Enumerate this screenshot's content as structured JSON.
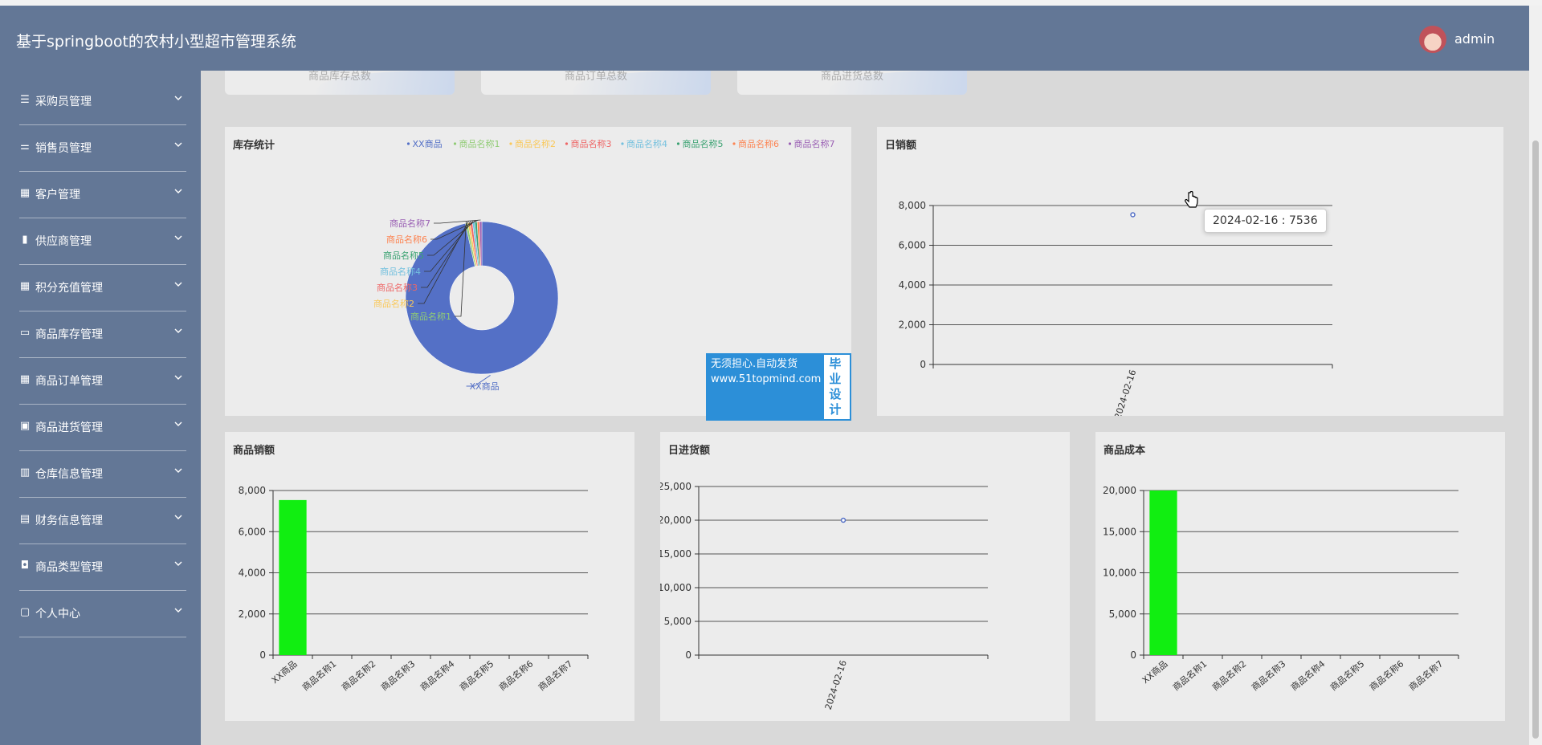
{
  "app": {
    "title": "基于springboot的农村小型超市管理系统",
    "user": "admin"
  },
  "sidebar": {
    "items": [
      {
        "label": "采购员管理",
        "icon": "list-icon"
      },
      {
        "label": "销售员管理",
        "icon": "sliders-icon"
      },
      {
        "label": "客户管理",
        "icon": "grid-icon"
      },
      {
        "label": "供应商管理",
        "icon": "bar-chart-icon"
      },
      {
        "label": "积分充值管理",
        "icon": "grid-icon"
      },
      {
        "label": "商品库存管理",
        "icon": "monitor-icon"
      },
      {
        "label": "商品订单管理",
        "icon": "grid-icon"
      },
      {
        "label": "商品进货管理",
        "icon": "file-x-icon"
      },
      {
        "label": "仓库信息管理",
        "icon": "columns-icon"
      },
      {
        "label": "财务信息管理",
        "icon": "presentation-icon"
      },
      {
        "label": "商品类型管理",
        "icon": "briefcase-icon"
      },
      {
        "label": "个人中心",
        "icon": "window-icon"
      }
    ]
  },
  "stat_cards": [
    {
      "label": "商品库存总数"
    },
    {
      "label": "商品订单总数"
    },
    {
      "label": "商品进货总数"
    }
  ],
  "panels": {
    "stock": {
      "title": "库存统计"
    },
    "daily_sales": {
      "title": "日销额"
    },
    "product_sales": {
      "title": "商品销额"
    },
    "daily_purchase": {
      "title": "日进货额"
    },
    "product_cost": {
      "title": "商品成本"
    }
  },
  "tooltip": {
    "text": "2024-02-16 : 7536"
  },
  "watermark": {
    "line1": "无须担心.自动发货",
    "line2": "www.51topmind.com",
    "badge1": "毕业",
    "badge2": "设计"
  },
  "chart_data": [
    {
      "id": "stock",
      "type": "pie",
      "title": "库存统计",
      "legend": "top-right",
      "categories": [
        "XX商品",
        "商品名称1",
        "商品名称2",
        "商品名称3",
        "商品名称4",
        "商品名称5",
        "商品名称6",
        "商品名称7"
      ],
      "values": [
        970,
        5,
        5,
        5,
        5,
        5,
        5,
        5
      ],
      "colors": [
        "#5470c6",
        "#91cc75",
        "#fac858",
        "#ee6666",
        "#73c0de",
        "#3ba272",
        "#fc8452",
        "#9a60b4"
      ]
    },
    {
      "id": "daily_sales",
      "type": "line",
      "title": "日销额",
      "x": [
        "2024-02-16"
      ],
      "values": [
        7536
      ],
      "ylim": [
        0,
        8000
      ],
      "yticks": [
        "0",
        "2,000",
        "4,000",
        "6,000",
        "8,000"
      ],
      "grid": true
    },
    {
      "id": "product_sales",
      "type": "bar",
      "title": "商品销额",
      "categories": [
        "XX商品",
        "商品名称1",
        "商品名称2",
        "商品名称3",
        "商品名称4",
        "商品名称5",
        "商品名称6",
        "商品名称7"
      ],
      "values": [
        7536,
        0,
        0,
        0,
        0,
        0,
        0,
        0
      ],
      "ylim": [
        0,
        8000
      ],
      "yticks": [
        "0",
        "2,000",
        "4,000",
        "6,000",
        "8,000"
      ],
      "color": "#11ee11",
      "grid": true
    },
    {
      "id": "daily_purchase",
      "type": "line",
      "title": "日进货额",
      "x": [
        "2024-02-16"
      ],
      "values": [
        20000
      ],
      "ylim": [
        0,
        25000
      ],
      "yticks": [
        "0",
        "5,000",
        "10,000",
        "15,000",
        "20,000",
        "25,000"
      ],
      "grid": true
    },
    {
      "id": "product_cost",
      "type": "bar",
      "title": "商品成本",
      "categories": [
        "XX商品",
        "商品名称1",
        "商品名称2",
        "商品名称3",
        "商品名称4",
        "商品名称5",
        "商品名称6",
        "商品名称7"
      ],
      "values": [
        20000,
        0,
        0,
        0,
        0,
        0,
        0,
        0
      ],
      "ylim": [
        0,
        20000
      ],
      "yticks": [
        "0",
        "5,000",
        "10,000",
        "15,000",
        "20,000"
      ],
      "color": "#11ee11",
      "grid": true
    }
  ]
}
